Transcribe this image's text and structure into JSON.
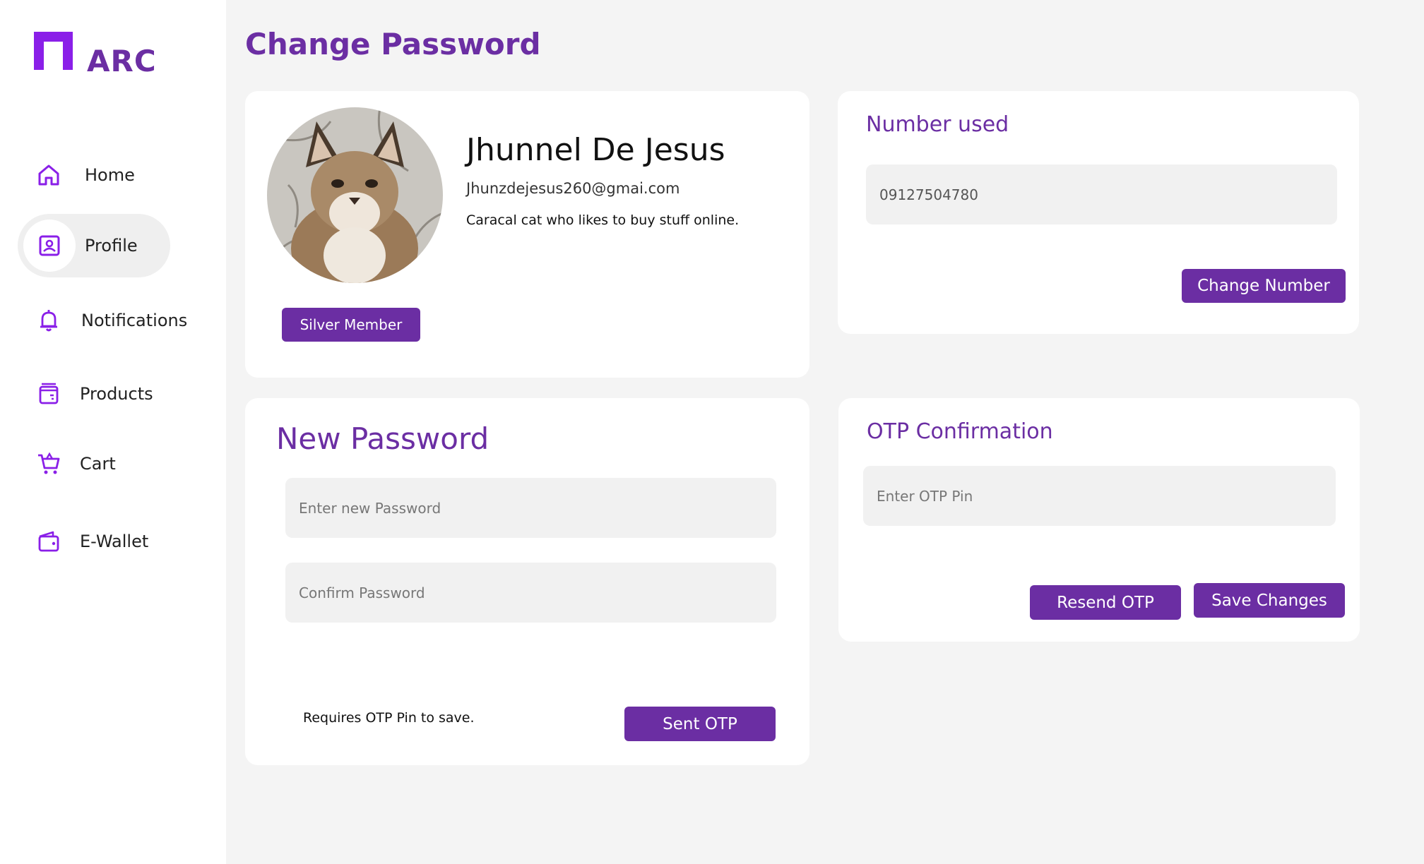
{
  "brand": {
    "name": "ARC",
    "color": "#8a1fe8"
  },
  "accent": "#6b2ea3",
  "sidebar": {
    "items": [
      {
        "label": "Home",
        "icon": "home-icon"
      },
      {
        "label": "Profile",
        "icon": "profile-card-icon",
        "active": true
      },
      {
        "label": "Notifications",
        "icon": "bell-icon"
      },
      {
        "label": "Products",
        "icon": "box-icon"
      },
      {
        "label": "Cart",
        "icon": "cart-icon"
      },
      {
        "label": "E-Wallet",
        "icon": "wallet-icon"
      }
    ]
  },
  "page": {
    "title": "Change Password"
  },
  "profile": {
    "name": "Jhunnel De Jesus",
    "email": "Jhunzdejesus260@gmai.com",
    "bio": "Caracal cat who likes to buy stuff online.",
    "badge": "Silver Member"
  },
  "number_card": {
    "title": "Number used",
    "value": "09127504780",
    "button": "Change Number"
  },
  "password_card": {
    "title": "New Password",
    "new_placeholder": "Enter new Password",
    "confirm_placeholder": "Confirm Password",
    "note": "Requires OTP Pin to save.",
    "button": "Sent OTP"
  },
  "otp_card": {
    "title": "OTP Confirmation",
    "placeholder": "Enter OTP Pin",
    "resend_button": "Resend OTP",
    "save_button": "Save Changes"
  }
}
